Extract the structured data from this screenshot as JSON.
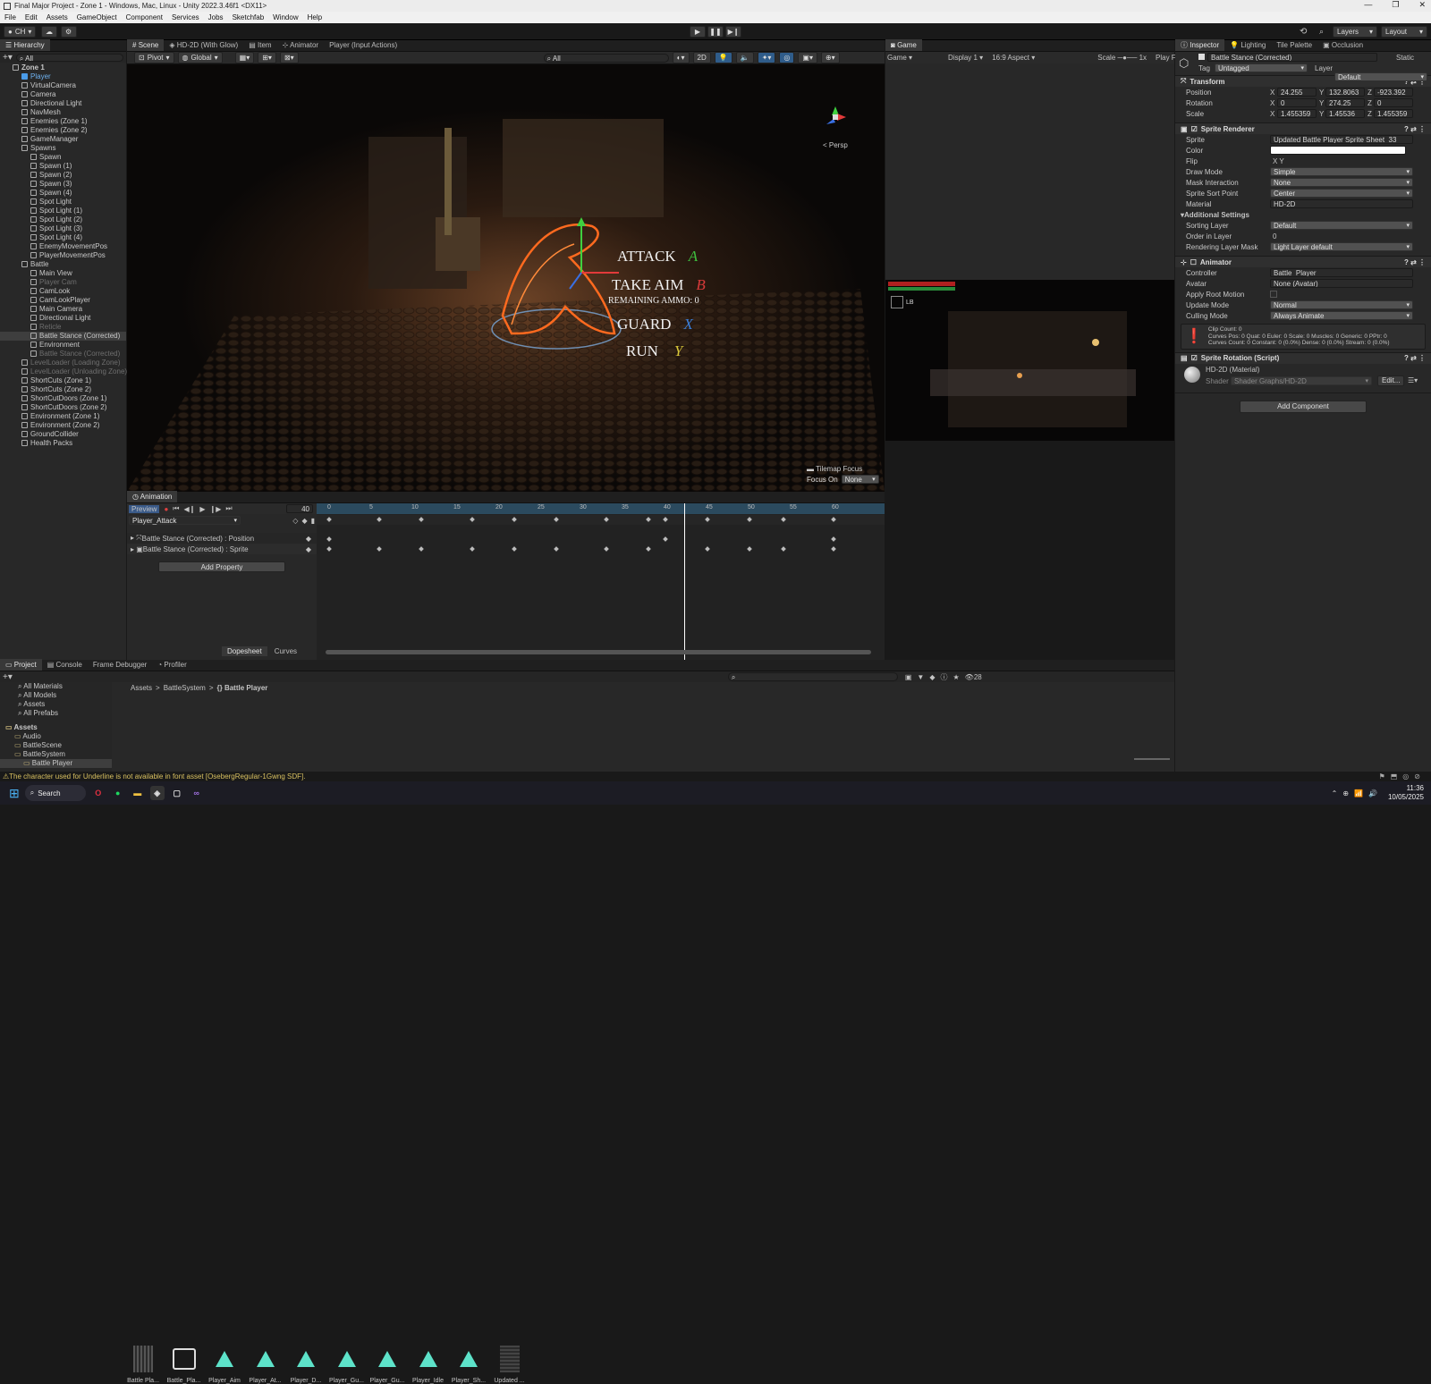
{
  "window": {
    "title": "Final Major Project - Zone 1 - Windows, Mac, Linux - Unity 2022.3.46f1 <DX11>"
  },
  "menu": [
    "File",
    "Edit",
    "Assets",
    "GameObject",
    "Component",
    "Services",
    "Jobs",
    "Sketchfab",
    "Window",
    "Help"
  ],
  "toolbar": {
    "account": "CH",
    "layers": "Layers",
    "layout": "Layout"
  },
  "hierarchy": {
    "tab": "Hierarchy",
    "search": "All",
    "items": [
      {
        "label": "Zone 1",
        "indent": 0,
        "bold": true
      },
      {
        "label": "Player",
        "indent": 1,
        "blue": true
      },
      {
        "label": "VirtualCamera",
        "indent": 1
      },
      {
        "label": "Camera",
        "indent": 1
      },
      {
        "label": "Directional Light",
        "indent": 1
      },
      {
        "label": "NavMesh",
        "indent": 1
      },
      {
        "label": "Enemies (Zone 1)",
        "indent": 1
      },
      {
        "label": "Enemies (Zone 2)",
        "indent": 1
      },
      {
        "label": "GameManager",
        "indent": 1
      },
      {
        "label": "Spawns",
        "indent": 1
      },
      {
        "label": "Spawn",
        "indent": 2
      },
      {
        "label": "Spawn (1)",
        "indent": 2
      },
      {
        "label": "Spawn (2)",
        "indent": 2
      },
      {
        "label": "Spawn (3)",
        "indent": 2
      },
      {
        "label": "Spawn (4)",
        "indent": 2
      },
      {
        "label": "Spot Light",
        "indent": 2
      },
      {
        "label": "Spot Light (1)",
        "indent": 2
      },
      {
        "label": "Spot Light (2)",
        "indent": 2
      },
      {
        "label": "Spot Light (3)",
        "indent": 2
      },
      {
        "label": "Spot Light (4)",
        "indent": 2
      },
      {
        "label": "EnemyMovementPos",
        "indent": 2
      },
      {
        "label": "PlayerMovementPos",
        "indent": 2
      },
      {
        "label": "Battle",
        "indent": 1
      },
      {
        "label": "Main View",
        "indent": 2
      },
      {
        "label": "Player Cam",
        "indent": 2,
        "dim": true
      },
      {
        "label": "CamLook",
        "indent": 2
      },
      {
        "label": "CamLookPlayer",
        "indent": 2
      },
      {
        "label": "Main Camera",
        "indent": 2
      },
      {
        "label": "Directional Light",
        "indent": 2
      },
      {
        "label": "Reticle",
        "indent": 2,
        "dim": true
      },
      {
        "label": "Battle Stance (Corrected)",
        "indent": 2,
        "sel": true
      },
      {
        "label": "Environment",
        "indent": 2
      },
      {
        "label": "Battle Stance (Corrected)",
        "indent": 2,
        "dim": true
      },
      {
        "label": "LevelLoader (Loading Zone)",
        "indent": 1,
        "dim": true
      },
      {
        "label": "LevelLoader (Unloading Zone)",
        "indent": 1,
        "dim": true
      },
      {
        "label": "ShortCuts (Zone 1)",
        "indent": 1
      },
      {
        "label": "ShortCuts (Zone 2)",
        "indent": 1
      },
      {
        "label": "ShortCutDoors (Zone 1)",
        "indent": 1
      },
      {
        "label": "ShortCutDoors (Zone 2)",
        "indent": 1
      },
      {
        "label": "Environment (Zone 1)",
        "indent": 1
      },
      {
        "label": "Environment (Zone 2)",
        "indent": 1
      },
      {
        "label": "GroundCollider",
        "indent": 1
      },
      {
        "label": "Health Packs",
        "indent": 1
      }
    ]
  },
  "scene": {
    "tabs": [
      "Scene",
      "HD-2D (With Glow)",
      "Item",
      "Animator",
      "Player (Input Actions)"
    ],
    "pivot": "Pivot",
    "global": "Global",
    "search": "All",
    "mode2d": "2D",
    "persp": "< Persp",
    "menu": [
      {
        "label": "ATTACK",
        "key": "A",
        "key_color": "#3fbf3f"
      },
      {
        "label": "TAKE AIM",
        "key": "B",
        "key_color": "#d83a3a"
      },
      {
        "label": "GUARD",
        "key": "X",
        "key_color": "#3b7fd9"
      },
      {
        "label": "RUN",
        "key": "Y",
        "key_color": "#d8c63a"
      }
    ],
    "ammo": "REMAINING AMMO: 0",
    "tilemap_focus": "Tilemap Focus",
    "focus_on": "Focus On",
    "focus_value": "None"
  },
  "game": {
    "tab": "Game",
    "mode": "Game",
    "display": "Display 1",
    "aspect": "16:9 Aspect",
    "scale_label": "Scale",
    "scale_value": "1x",
    "play_focus": "Play Focused",
    "lb": "LB"
  },
  "inspector": {
    "tabs": [
      "Inspector",
      "Lighting",
      "Tile Palette",
      "Occlusion"
    ],
    "object_name": "Battle Stance (Corrected)",
    "static": "Static",
    "tag_label": "Tag",
    "tag": "Untagged",
    "layer_label": "Layer",
    "layer": "Default",
    "transform": {
      "title": "Transform",
      "position": {
        "label": "Position",
        "x": "24.255",
        "y": "132.8063",
        "z": "-923.392"
      },
      "rotation": {
        "label": "Rotation",
        "x": "0",
        "y": "274.25",
        "z": "0"
      },
      "scale": {
        "label": "Scale",
        "x": "1.455359",
        "y": "1.45536",
        "z": "1.455359"
      }
    },
    "sprite_renderer": {
      "title": "Sprite Renderer",
      "rows": [
        {
          "label": "Sprite",
          "value": "Updated Battle Player Sprite Sheet_33",
          "type": "field"
        },
        {
          "label": "Color",
          "value": "",
          "type": "color"
        },
        {
          "label": "Flip",
          "value": "X    Y",
          "type": "flip"
        },
        {
          "label": "Draw Mode",
          "value": "Simple",
          "type": "drop"
        },
        {
          "label": "Mask Interaction",
          "value": "None",
          "type": "drop"
        },
        {
          "label": "Sprite Sort Point",
          "value": "Center",
          "type": "drop"
        },
        {
          "label": "Material",
          "value": "HD-2D",
          "type": "field"
        }
      ],
      "additional": "Additional Settings",
      "add_rows": [
        {
          "label": "Sorting Layer",
          "value": "Default",
          "type": "drop"
        },
        {
          "label": "Order in Layer",
          "value": "0",
          "type": "plain"
        },
        {
          "label": "Rendering Layer Mask",
          "value": "Light Layer default",
          "type": "drop"
        }
      ]
    },
    "animator": {
      "title": "Animator",
      "rows": [
        {
          "label": "Controller",
          "value": "Battle_Player",
          "type": "field"
        },
        {
          "label": "Avatar",
          "value": "None (Avatar)",
          "type": "field"
        },
        {
          "label": "Apply Root Motion",
          "value": "",
          "type": "check"
        },
        {
          "label": "Update Mode",
          "value": "Normal",
          "type": "drop"
        },
        {
          "label": "Culling Mode",
          "value": "Always Animate",
          "type": "drop"
        }
      ],
      "info1": "Clip Count: 0",
      "info2": "Curves Pos: 0 Quat: 0 Euler: 0 Scale: 0 Muscles: 0 Generic: 0 PPtr: 0",
      "info3": "Curves Count: 0 Constant: 0 (0.0%) Dense: 0 (0.0%) Stream: 0 (0.0%)"
    },
    "sprite_rotation": {
      "title": "Sprite Rotation (Script)"
    },
    "material": {
      "title": "HD-2D (Material)",
      "shader_label": "Shader",
      "shader": "Shader Graphs/HD-2D",
      "edit": "Edit..."
    },
    "add_component": "Add Component"
  },
  "animation": {
    "tab": "Animation",
    "preview": "Preview",
    "frame": "40",
    "clip": "Player_Attack",
    "properties": [
      "Battle Stance (Corrected) : Position",
      "Battle Stance (Corrected) : Sprite"
    ],
    "add_property": "Add Property",
    "dopesheet": "Dopesheet",
    "curves": "Curves",
    "ticks": [
      "0",
      "5",
      "10",
      "15",
      "20",
      "25",
      "30",
      "35",
      "40",
      "45",
      "50",
      "55",
      "60"
    ]
  },
  "project": {
    "tabs": [
      "Project",
      "Console",
      "Frame Debugger",
      "Profiler"
    ],
    "favorites": [
      "All Materials",
      "All Models",
      "Assets",
      "All Prefabs"
    ],
    "tree": [
      "Assets",
      "Audio",
      "BattleScene",
      "BattleSystem",
      "Battle Player"
    ],
    "breadcrumb": [
      "Assets",
      "BattleSystem",
      "Battle Player"
    ],
    "assets": [
      "Battle Pla...",
      "Battle_Pla...",
      "Player_Aim",
      "Player_At...",
      "Player_D...",
      "Player_Gu...",
      "Player_Gu...",
      "Player_Idle",
      "Player_Sh...",
      "Updated ..."
    ],
    "count": "28"
  },
  "status": {
    "warning": "The character used for Underline is not available in font asset [OsebergRegular-1Gwng SDF]."
  },
  "taskbar": {
    "search": "Search",
    "time": "11:36",
    "date": "10/05/2025"
  }
}
